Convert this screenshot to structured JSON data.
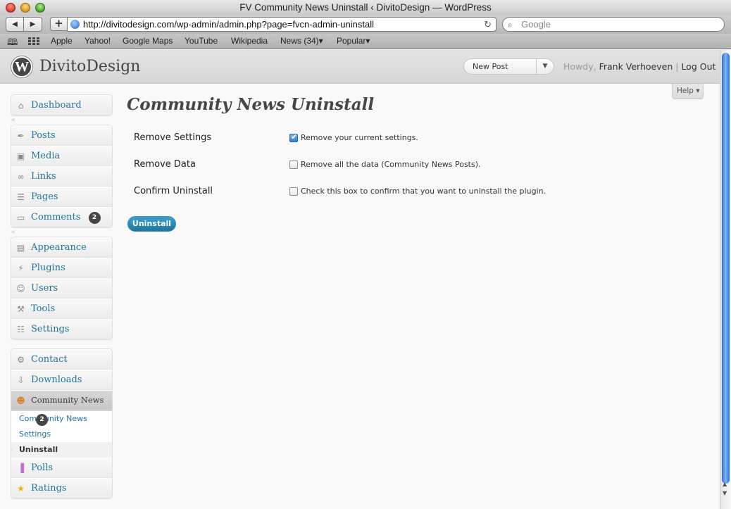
{
  "browser": {
    "window_title": "FV Community News Uninstall ‹ DivitoDesign — WordPress",
    "back_label": "◀",
    "forward_label": "▶",
    "add_label": "+",
    "url": "http://divitodesign.com/wp-admin/admin.php?page=fvcn-admin-uninstall",
    "search_placeholder": "Google",
    "bookmarks": [
      "Apple",
      "Yahoo!",
      "Google Maps",
      "YouTube",
      "Wikipedia",
      "News (34)▾",
      "Popular▾"
    ]
  },
  "header": {
    "site_title": "DivitoDesign",
    "new_post_label": "New Post",
    "howdy": "Howdy,",
    "user_name": "Frank Verhoeven",
    "separator": "|",
    "logout_label": "Log Out",
    "help_label": "Help ▾"
  },
  "sidebar": {
    "dashboard": "Dashboard",
    "posts": "Posts",
    "media": "Media",
    "links": "Links",
    "pages": "Pages",
    "comments": "Comments",
    "comments_count": "2",
    "appearance": "Appearance",
    "plugins": "Plugins",
    "users": "Users",
    "tools": "Tools",
    "settings": "Settings",
    "contact": "Contact",
    "downloads": "Downloads",
    "community_news": "Community News",
    "community_news_count": "2",
    "submenu": [
      "Community News",
      "Settings",
      "Uninstall"
    ],
    "polls": "Polls",
    "ratings": "Ratings"
  },
  "main": {
    "title": "Community News Uninstall",
    "rows": [
      {
        "label": "Remove Settings",
        "description": "Remove your current settings.",
        "checked": true
      },
      {
        "label": "Remove Data",
        "description": "Remove all the data (Community News Posts).",
        "checked": false
      },
      {
        "label": "Confirm Uninstall",
        "description": "Check this box to confirm that you want to uninstall the plugin.",
        "checked": false
      }
    ],
    "uninstall_button": "Uninstall"
  },
  "colors": {
    "link": "#21759b",
    "button": "#21759b",
    "header": "#464646"
  }
}
